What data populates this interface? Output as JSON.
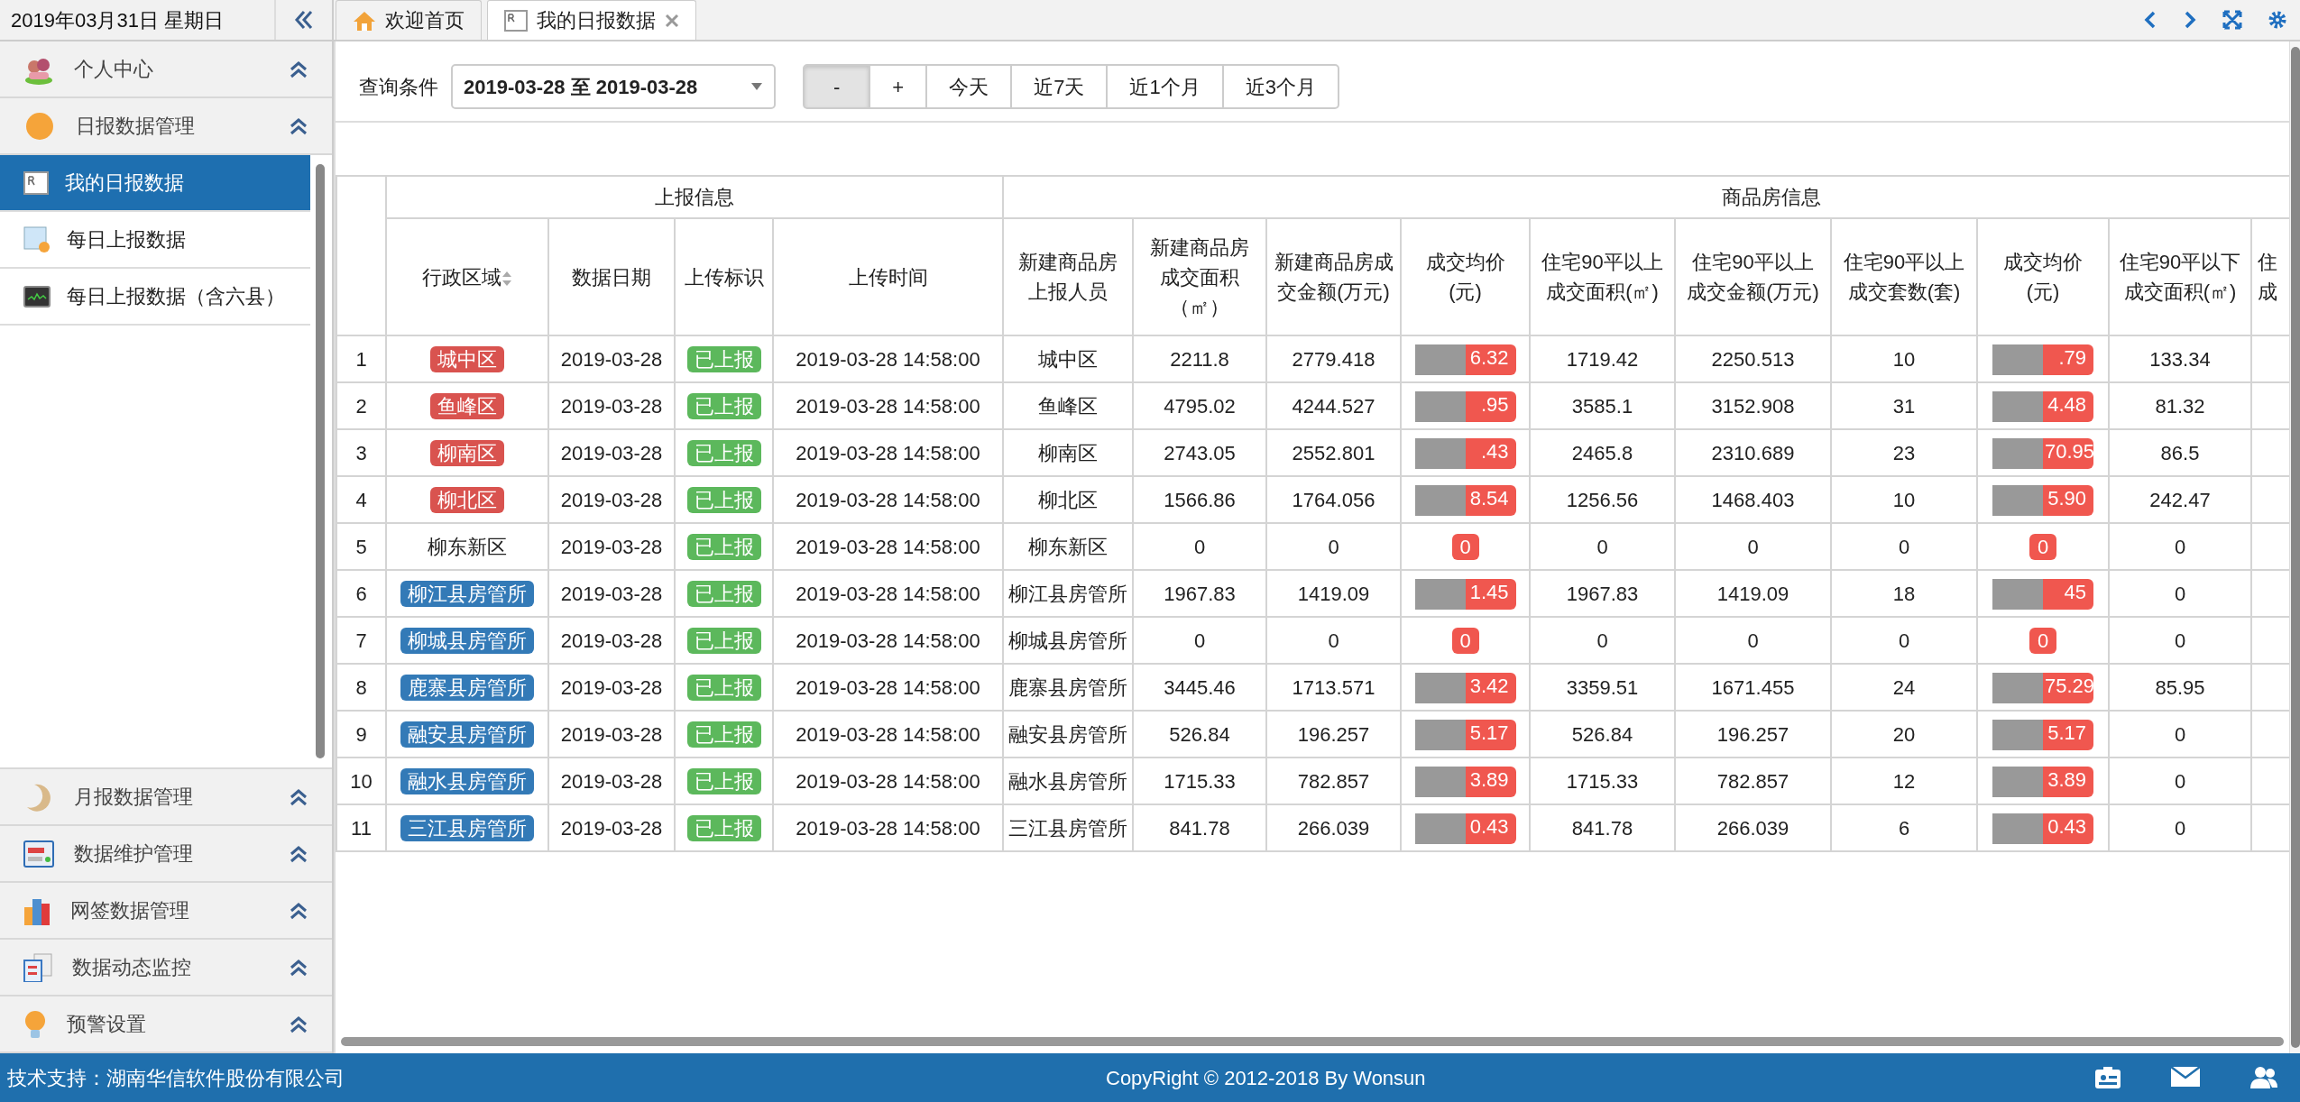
{
  "header": {
    "date": "2019年03月31日 星期日"
  },
  "tabs": [
    {
      "label": "欢迎首页",
      "selected": false,
      "closable": false
    },
    {
      "label": "我的日报数据",
      "selected": true,
      "closable": true
    }
  ],
  "sidebar": {
    "groups": [
      {
        "label": "个人中心"
      },
      {
        "label": "日报数据管理",
        "children": [
          {
            "label": "我的日报数据",
            "selected": true
          },
          {
            "label": "每日上报数据",
            "selected": false
          },
          {
            "label": "每日上报数据（含六县）",
            "selected": false
          }
        ]
      },
      {
        "label": "月报数据管理"
      },
      {
        "label": "数据维护管理"
      },
      {
        "label": "网签数据管理"
      },
      {
        "label": "数据动态监控"
      },
      {
        "label": "预警设置"
      }
    ]
  },
  "query": {
    "label": "查询条件",
    "range": "2019-03-28 至 2019-03-28",
    "buttons": [
      {
        "label": "-",
        "selected": true
      },
      {
        "label": "+",
        "selected": false
      },
      {
        "label": "今天",
        "selected": false
      },
      {
        "label": "近7天",
        "selected": false
      },
      {
        "label": "近1个月",
        "selected": false
      },
      {
        "label": "近3个月",
        "selected": false
      }
    ]
  },
  "table": {
    "column_groups": [
      {
        "label": "上报信息",
        "columns": [
          {
            "lines": [
              "行政区域"
            ],
            "sortable": true
          },
          {
            "lines": [
              "数据日期"
            ],
            "sortable": false
          },
          {
            "lines": [
              "上传标识"
            ],
            "sortable": false
          },
          {
            "lines": [
              "上传时间"
            ],
            "sortable": false
          }
        ]
      },
      {
        "label": "商品房信息",
        "columns": [
          {
            "lines": [
              "新建商品房",
              "上报人员"
            ],
            "sortable": false
          },
          {
            "lines": [
              "新建商品房",
              "成交面积",
              "（㎡）"
            ],
            "sortable": false
          },
          {
            "lines": [
              "新建商品房成",
              "交金额(万元)"
            ],
            "sortable": false
          },
          {
            "lines": [
              "成交均价",
              "(元)"
            ],
            "sortable": false
          },
          {
            "lines": [
              "住宅90平以上",
              "成交面积(㎡)"
            ],
            "sortable": false
          },
          {
            "lines": [
              "住宅90平以上",
              "成交金额(万元)"
            ],
            "sortable": false
          },
          {
            "lines": [
              "住宅90平以上",
              "成交套数(套)"
            ],
            "sortable": false
          },
          {
            "lines": [
              "成交均价",
              "(元)"
            ],
            "sortable": false
          },
          {
            "lines": [
              "住宅90平以下",
              "成交面积(㎡)"
            ],
            "sortable": false
          },
          {
            "lines": [
              "住",
              "成"
            ],
            "sortable": false
          }
        ]
      }
    ],
    "rows": [
      {
        "no": "1",
        "region": {
          "text": "城中区",
          "color": "#d9534f"
        },
        "date": "2019-03-28",
        "flag": "已上报",
        "time": "2019-03-28 14:58:00",
        "reporter": "城中区",
        "area": "2211.8",
        "amount": "2779.418",
        "price": {
          "text": "6.32",
          "redacted": true
        },
        "area90": "1719.42",
        "amount90": "2250.513",
        "count90": "10",
        "price2": {
          "text": ".79",
          "redacted": true
        },
        "area_under90": "133.34"
      },
      {
        "no": "2",
        "region": {
          "text": "鱼峰区",
          "color": "#d9534f"
        },
        "date": "2019-03-28",
        "flag": "已上报",
        "time": "2019-03-28 14:58:00",
        "reporter": "鱼峰区",
        "area": "4795.02",
        "amount": "4244.527",
        "price": {
          "text": ".95",
          "redacted": true
        },
        "area90": "3585.1",
        "amount90": "3152.908",
        "count90": "31",
        "price2": {
          "text": "4.48",
          "redacted": true
        },
        "area_under90": "81.32"
      },
      {
        "no": "3",
        "region": {
          "text": "柳南区",
          "color": "#d9534f"
        },
        "date": "2019-03-28",
        "flag": "已上报",
        "time": "2019-03-28 14:58:00",
        "reporter": "柳南区",
        "area": "2743.05",
        "amount": "2552.801",
        "price": {
          "text": ".43",
          "redacted": true
        },
        "area90": "2465.8",
        "amount90": "2310.689",
        "count90": "23",
        "price2": {
          "text": "70.95",
          "redacted": true
        },
        "area_under90": "86.5"
      },
      {
        "no": "4",
        "region": {
          "text": "柳北区",
          "color": "#d9534f"
        },
        "date": "2019-03-28",
        "flag": "已上报",
        "time": "2019-03-28 14:58:00",
        "reporter": "柳北区",
        "area": "1566.86",
        "amount": "1764.056",
        "price": {
          "text": "8.54",
          "redacted": true
        },
        "area90": "1256.56",
        "amount90": "1468.403",
        "count90": "10",
        "price2": {
          "text": "5.90",
          "redacted": true
        },
        "area_under90": "242.47"
      },
      {
        "no": "5",
        "region": {
          "text": "柳东新区"
        },
        "date": "2019-03-28",
        "flag": "已上报",
        "time": "2019-03-28 14:58:00",
        "reporter": "柳东新区",
        "area": "0",
        "amount": "0",
        "price": {
          "text": "0",
          "redacted": false
        },
        "area90": "0",
        "amount90": "0",
        "count90": "0",
        "price2": {
          "text": "0",
          "redacted": false
        },
        "area_under90": "0"
      },
      {
        "no": "6",
        "region": {
          "text": "柳江县房管所",
          "color": "#337ab7"
        },
        "date": "2019-03-28",
        "flag": "已上报",
        "time": "2019-03-28 14:58:00",
        "reporter": "柳江县房管所",
        "area": "1967.83",
        "amount": "1419.09",
        "price": {
          "text": "1.45",
          "redacted": true
        },
        "area90": "1967.83",
        "amount90": "1419.09",
        "count90": "18",
        "price2": {
          "text": "45",
          "redacted": true
        },
        "area_under90": "0"
      },
      {
        "no": "7",
        "region": {
          "text": "柳城县房管所",
          "color": "#337ab7"
        },
        "date": "2019-03-28",
        "flag": "已上报",
        "time": "2019-03-28 14:58:00",
        "reporter": "柳城县房管所",
        "area": "0",
        "amount": "0",
        "price": {
          "text": "0",
          "redacted": false
        },
        "area90": "0",
        "amount90": "0",
        "count90": "0",
        "price2": {
          "text": "0",
          "redacted": false
        },
        "area_under90": "0"
      },
      {
        "no": "8",
        "region": {
          "text": "鹿寨县房管所",
          "color": "#337ab7"
        },
        "date": "2019-03-28",
        "flag": "已上报",
        "time": "2019-03-28 14:58:00",
        "reporter": "鹿寨县房管所",
        "area": "3445.46",
        "amount": "1713.571",
        "price": {
          "text": "3.42",
          "redacted": true
        },
        "area90": "3359.51",
        "amount90": "1671.455",
        "count90": "24",
        "price2": {
          "text": "75.29",
          "redacted": true
        },
        "area_under90": "85.95"
      },
      {
        "no": "9",
        "region": {
          "text": "融安县房管所",
          "color": "#337ab7"
        },
        "date": "2019-03-28",
        "flag": "已上报",
        "time": "2019-03-28 14:58:00",
        "reporter": "融安县房管所",
        "area": "526.84",
        "amount": "196.257",
        "price": {
          "text": "5.17",
          "redacted": true
        },
        "area90": "526.84",
        "amount90": "196.257",
        "count90": "20",
        "price2": {
          "text": "5.17",
          "redacted": true
        },
        "area_under90": "0"
      },
      {
        "no": "10",
        "region": {
          "text": "融水县房管所",
          "color": "#337ab7"
        },
        "date": "2019-03-28",
        "flag": "已上报",
        "time": "2019-03-28 14:58:00",
        "reporter": "融水县房管所",
        "area": "1715.33",
        "amount": "782.857",
        "price": {
          "text": "3.89",
          "redacted": true
        },
        "area90": "1715.33",
        "amount90": "782.857",
        "count90": "12",
        "price2": {
          "text": "3.89",
          "redacted": true
        },
        "area_under90": "0"
      },
      {
        "no": "11",
        "region": {
          "text": "三江县房管所",
          "color": "#337ab7"
        },
        "date": "2019-03-28",
        "flag": "已上报",
        "time": "2019-03-28 14:58:00",
        "reporter": "三江县房管所",
        "area": "841.78",
        "amount": "266.039",
        "price": {
          "text": "0.43",
          "redacted": true
        },
        "area90": "841.78",
        "amount90": "266.039",
        "count90": "6",
        "price2": {
          "text": "0.43",
          "redacted": true
        },
        "area_under90": "0"
      }
    ]
  },
  "footer": {
    "support": "技术支持：湖南华信软件股份有限公司",
    "copyright": "CopyRight © 2012-2018 By Wonsun"
  }
}
